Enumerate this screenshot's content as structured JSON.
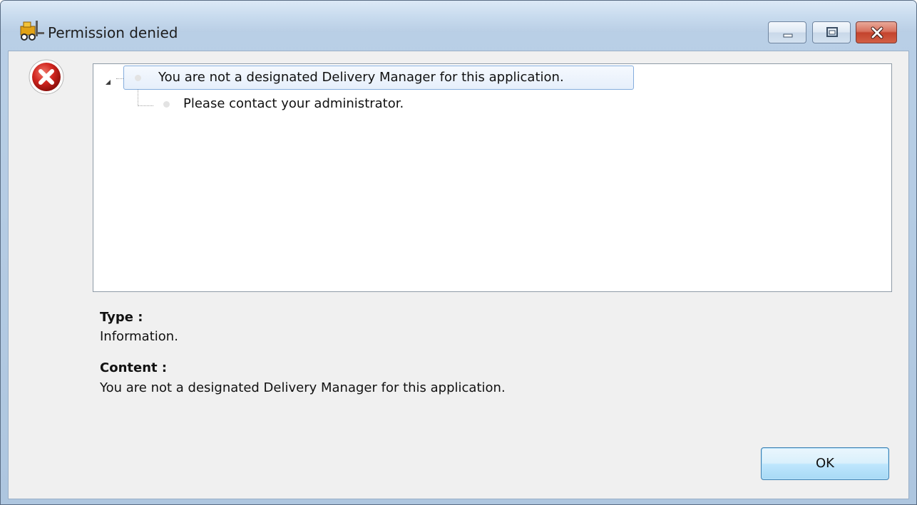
{
  "window": {
    "title": "Permission denied",
    "app_icon": "forklift-icon",
    "controls": {
      "minimize": "minimize-icon",
      "maximize": "maximize-icon",
      "close": "close-icon"
    }
  },
  "dialog": {
    "status_icon": "error-icon",
    "tree": {
      "root": "You are not a designated Delivery Manager for this application.",
      "children": [
        "Please contact your administrator."
      ]
    },
    "type_label": "Type :",
    "type_value": "Information.",
    "content_label": "Content :",
    "content_value": "You are not a designated Delivery Manager for this application.",
    "ok_label": "OK"
  },
  "colors": {
    "titlebar": "#c8dbee",
    "client_background": "#f0f0f0",
    "error_red": "#d1251f",
    "close_button": "#c3432d",
    "selection_border": "#84acdd"
  }
}
